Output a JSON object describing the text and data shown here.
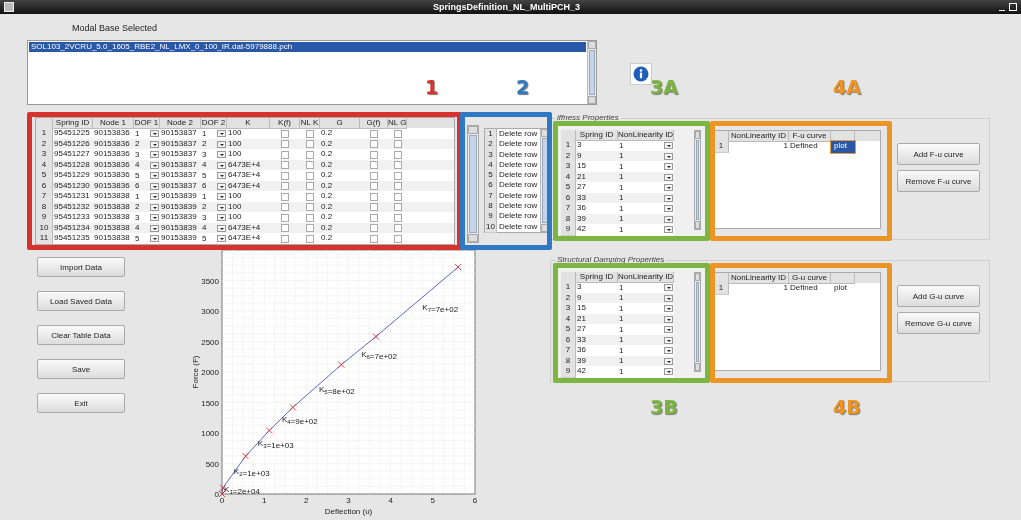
{
  "window": {
    "title": "SpringsDefinition_NL_MultiPCH_3"
  },
  "modal_base": {
    "label": "Modal Base Selected",
    "items": [
      {
        "text": "SOL103_2VCRU_5.0_1605_RBE2_NL_LMX_0_100_IR.dat-5979888.pch",
        "selected": true
      }
    ]
  },
  "springs_table": {
    "columns": [
      "Spring ID",
      "Node 1",
      "DOF 1",
      "Node 2",
      "DOF 2",
      "K",
      "K(f)",
      "NL K",
      "G",
      "G(f)",
      "NL G"
    ],
    "rows": [
      {
        "n": "1",
        "spring_id": "95451225",
        "node_1": "90153836",
        "dof_1": "1",
        "node_2": "90153837",
        "dof_2": "1",
        "k": "100",
        "k_f": false,
        "nl_k": false,
        "g": "0.2",
        "g_f": false,
        "nl_g": false
      },
      {
        "n": "2",
        "spring_id": "95451226",
        "node_1": "90153836",
        "dof_1": "2",
        "node_2": "90153837",
        "dof_2": "2",
        "k": "100",
        "k_f": false,
        "nl_k": false,
        "g": "0.2",
        "g_f": false,
        "nl_g": false
      },
      {
        "n": "3",
        "spring_id": "95451227",
        "node_1": "90153836",
        "dof_1": "3",
        "node_2": "90153837",
        "dof_2": "3",
        "k": "100",
        "k_f": false,
        "nl_k": false,
        "g": "0.2",
        "g_f": false,
        "nl_g": false
      },
      {
        "n": "4",
        "spring_id": "95451228",
        "node_1": "90153836",
        "dof_1": "4",
        "node_2": "90153837",
        "dof_2": "4",
        "k": "6473E+4",
        "k_f": false,
        "nl_k": false,
        "g": "0.2",
        "g_f": false,
        "nl_g": false
      },
      {
        "n": "5",
        "spring_id": "95451229",
        "node_1": "90153836",
        "dof_1": "5",
        "node_2": "90153837",
        "dof_2": "5",
        "k": "6473E+4",
        "k_f": false,
        "nl_k": false,
        "g": "0.2",
        "g_f": false,
        "nl_g": false
      },
      {
        "n": "6",
        "spring_id": "95451230",
        "node_1": "90153836",
        "dof_1": "6",
        "node_2": "90153837",
        "dof_2": "6",
        "k": "6473E+4",
        "k_f": false,
        "nl_k": false,
        "g": "0.2",
        "g_f": false,
        "nl_g": false
      },
      {
        "n": "7",
        "spring_id": "95451231",
        "node_1": "90153838",
        "dof_1": "1",
        "node_2": "90153839",
        "dof_2": "1",
        "k": "100",
        "k_f": false,
        "nl_k": false,
        "g": "0.2",
        "g_f": false,
        "nl_g": false
      },
      {
        "n": "8",
        "spring_id": "95451232",
        "node_1": "90153838",
        "dof_1": "2",
        "node_2": "90153839",
        "dof_2": "2",
        "k": "100",
        "k_f": false,
        "nl_k": false,
        "g": "0.2",
        "g_f": false,
        "nl_g": false
      },
      {
        "n": "9",
        "spring_id": "95451233",
        "node_1": "90153838",
        "dof_1": "3",
        "node_2": "90153839",
        "dof_2": "3",
        "k": "100",
        "k_f": false,
        "nl_k": false,
        "g": "0.2",
        "g_f": false,
        "nl_g": false
      },
      {
        "n": "10",
        "spring_id": "95451234",
        "node_1": "90153838",
        "dof_1": "4",
        "node_2": "90153839",
        "dof_2": "4",
        "k": "6473E+4",
        "k_f": false,
        "nl_k": false,
        "g": "0.2",
        "g_f": false,
        "nl_g": false
      },
      {
        "n": "11",
        "spring_id": "95451235",
        "node_1": "90153838",
        "dof_1": "5",
        "node_2": "90153839",
        "dof_2": "5",
        "k": "6473E+4",
        "k_f": false,
        "nl_k": false,
        "g": "0.2",
        "g_f": false,
        "nl_g": false
      }
    ]
  },
  "delete_rows": [
    {
      "n": "1",
      "label": "Delete row"
    },
    {
      "n": "2",
      "label": "Delete row"
    },
    {
      "n": "3",
      "label": "Delete row"
    },
    {
      "n": "4",
      "label": "Delete row"
    },
    {
      "n": "5",
      "label": "Delete row"
    },
    {
      "n": "6",
      "label": "Delete row"
    },
    {
      "n": "7",
      "label": "Delete row"
    },
    {
      "n": "8",
      "label": "Delete row"
    },
    {
      "n": "9",
      "label": "Delete row"
    },
    {
      "n": "10",
      "label": "Delete row"
    }
  ],
  "buttons": [
    "Import Data",
    "Load Saved Data",
    "Clear Table Data",
    "Save",
    "Exit"
  ],
  "chart": {
    "chart_data": {
      "type": "line",
      "xlabel": "Deflection (u)",
      "ylabel": "Force (F)",
      "x": [
        0,
        0.02,
        0.56,
        1.12,
        1.68,
        2.83,
        3.65,
        5.6
      ],
      "series": [
        {
          "color": "#4a52c8",
          "values": [
            0,
            100,
            620,
            1040,
            1420,
            2120,
            2580,
            3720
          ]
        }
      ],
      "xlim": [
        0,
        6
      ],
      "ylim": [
        0,
        4000
      ],
      "xticks": [
        0,
        1,
        2,
        3,
        4,
        5,
        6
      ],
      "yticks": [
        0,
        500,
        1000,
        1500,
        2000,
        2500,
        3000,
        3500
      ],
      "grid": true,
      "annotations": [
        "K$_{1}$=2e+04",
        "K$_{2}$=1e+03",
        "K$_{3}$=1e+03",
        "K$_{4}$=9e+02",
        "K$_{5}$=8e+02",
        "K$_{6}$=7e+02",
        "K$_{7}$=7e+02"
      ]
    }
  },
  "stiffness": {
    "title": "iffness Properties",
    "springs": {
      "columns": [
        "Spring ID",
        "NonLinearity ID"
      ],
      "rows": [
        {
          "n": "1",
          "spring_id": "3",
          "nonlinearity_id": "1"
        },
        {
          "n": "2",
          "spring_id": "9",
          "nonlinearity_id": "1"
        },
        {
          "n": "3",
          "spring_id": "15",
          "nonlinearity_id": "1"
        },
        {
          "n": "4",
          "spring_id": "21",
          "nonlinearity_id": "1"
        },
        {
          "n": "5",
          "spring_id": "27",
          "nonlinearity_id": "1"
        },
        {
          "n": "6",
          "spring_id": "33",
          "nonlinearity_id": "1"
        },
        {
          "n": "7",
          "spring_id": "36",
          "nonlinearity_id": "1"
        },
        {
          "n": "8",
          "spring_id": "39",
          "nonlinearity_id": "1"
        },
        {
          "n": "9",
          "spring_id": "42",
          "nonlinearity_id": "1"
        }
      ]
    },
    "curves": {
      "columns": [
        "NonLinearity ID",
        "F-u curve"
      ],
      "rows": [
        {
          "n": "1",
          "nonlinearity_id": "1",
          "curve": "Defined",
          "action": "plot",
          "selected": true
        }
      ]
    },
    "buttons": [
      "Add F-u curve",
      "Remove F-u curve"
    ]
  },
  "damping": {
    "title": "Structural Damping Properties",
    "springs": {
      "columns": [
        "Spring ID",
        "NonLinearity ID"
      ],
      "rows": [
        {
          "n": "1",
          "spring_id": "3",
          "nonlinearity_id": "1"
        },
        {
          "n": "2",
          "spring_id": "9",
          "nonlinearity_id": "1"
        },
        {
          "n": "3",
          "spring_id": "15",
          "nonlinearity_id": "1"
        },
        {
          "n": "4",
          "spring_id": "21",
          "nonlinearity_id": "1"
        },
        {
          "n": "5",
          "spring_id": "27",
          "nonlinearity_id": "1"
        },
        {
          "n": "6",
          "spring_id": "33",
          "nonlinearity_id": "1"
        },
        {
          "n": "7",
          "spring_id": "36",
          "nonlinearity_id": "1"
        },
        {
          "n": "8",
          "spring_id": "39",
          "nonlinearity_id": "1"
        },
        {
          "n": "9",
          "spring_id": "42",
          "nonlinearity_id": "1"
        }
      ]
    },
    "curves": {
      "columns": [
        "NonLinearity ID",
        "G-u curve"
      ],
      "rows": [
        {
          "n": "1",
          "nonlinearity_id": "1",
          "curve": "Defined",
          "action": "plot",
          "selected": false
        }
      ]
    },
    "buttons": [
      "Add G-u curve",
      "Remove G-u curve"
    ]
  },
  "annotations": [
    {
      "label": "1",
      "color": "#d8322e"
    },
    {
      "label": "2",
      "color": "#2f78c4"
    },
    {
      "label": "3A",
      "color": "#7db542"
    },
    {
      "label": "4A",
      "color": "#ec9424"
    },
    {
      "label": "3B",
      "color": "#7db542"
    },
    {
      "label": "4B",
      "color": "#ec9424"
    }
  ]
}
